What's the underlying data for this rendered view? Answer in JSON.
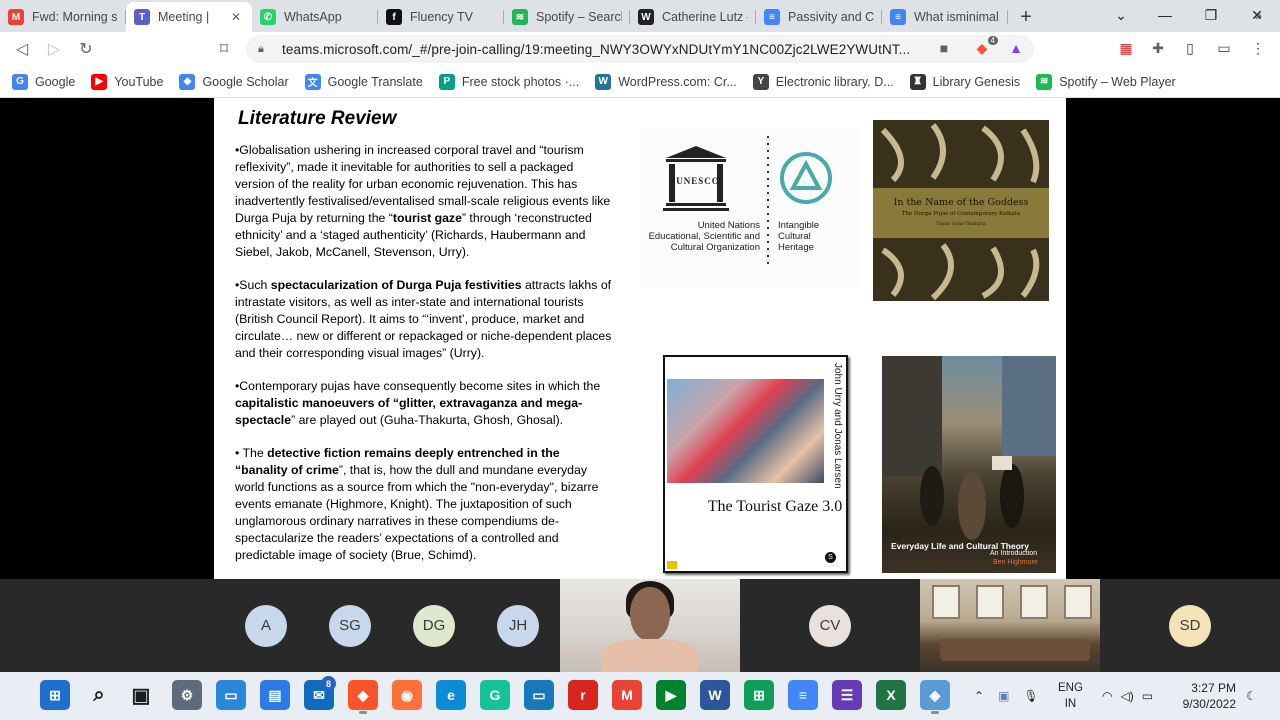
{
  "browser": {
    "tabs": [
      {
        "title": "Fwd: Morning se",
        "icon": "gmail-icon",
        "color": "#ea4335",
        "glyph": "M"
      },
      {
        "title": "Meeting |",
        "icon": "teams-icon",
        "color": "#5b5fc7",
        "glyph": "T",
        "active": true
      },
      {
        "title": "WhatsApp",
        "icon": "whatsapp-icon",
        "color": "#25d366",
        "glyph": "✆"
      },
      {
        "title": "Fluency TV",
        "icon": "fluency-icon",
        "color": "#111111",
        "glyph": "f"
      },
      {
        "title": "Spotify – Search",
        "icon": "spotify-icon",
        "color": "#1db954",
        "glyph": "≋"
      },
      {
        "title": "Catherine Lutz -",
        "icon": "wikipedia-icon",
        "color": "#222222",
        "glyph": "W"
      },
      {
        "title": "Passivity and Cre",
        "icon": "docs-icon",
        "color": "#4285f4",
        "glyph": "≡"
      },
      {
        "title": "What isminimal.c",
        "icon": "docs-icon",
        "color": "#4285f4",
        "glyph": "≡"
      }
    ],
    "new_tab": "+",
    "url": "teams.microsoft.com/_#/pre-join-calling/19:meeting_NWY3OWYxNDUtYmY1NC00Zjc2LWE2YWUtNT...",
    "brave_badge": "4",
    "bookmarks": [
      {
        "label": "Google",
        "icon": "google-icon",
        "color": "#4285f4",
        "glyph": "G"
      },
      {
        "label": "YouTube",
        "icon": "youtube-icon",
        "color": "#ff0000",
        "glyph": "▶"
      },
      {
        "label": "Google Scholar",
        "icon": "scholar-icon",
        "color": "#4285f4",
        "glyph": "◆"
      },
      {
        "label": "Google Translate",
        "icon": "translate-icon",
        "color": "#4285f4",
        "glyph": "文"
      },
      {
        "label": "Free stock photos ·...",
        "icon": "pexels-icon",
        "color": "#05a081",
        "glyph": "P"
      },
      {
        "label": "WordPress.com: Cr...",
        "icon": "wordpress-icon",
        "color": "#21759b",
        "glyph": "W"
      },
      {
        "label": "Electronic library. D...",
        "icon": "library-icon",
        "color": "#444444",
        "glyph": "Y"
      },
      {
        "label": "Library Genesis",
        "icon": "libgen-icon",
        "color": "#333333",
        "glyph": "♜"
      },
      {
        "label": "Spotify – Web Player",
        "icon": "spotify-icon",
        "color": "#1db954",
        "glyph": "≋"
      }
    ],
    "bookmarks_more": "»"
  },
  "slide": {
    "title": "Literature Review",
    "paragraphs": [
      {
        "html": "•Globalisation ushering in increased  corporal travel and “tourism reflexivity”, made it inevitable for authorities to sell a packaged version of the reality for urban economic rejuvenation. This has inadvertently festivalised/eventalised small-scale religious events like Durga Puja by returning the “<b>tourist gaze</b>” through ‘reconstructed ethnicity’ and a ‘staged authenticity’ (Richards, Haubermann and Siebel, Jakob, McCanell, Stevenson, Urry)."
      },
      {
        "html": "•Such <b>spectacularization of Durga Puja festivities</b> attracts lakhs of intrastate visitors, as well as inter-state and international tourists (British Council Report). It aims to “‘invent’, produce, market and circulate… new or different or repackaged or niche-dependent places and their corresponding visual images”  (Urry)."
      },
      {
        "html": "•Contemporary pujas have consequently become sites in which  the <b>capitalistic manoeuvers of “glitter, extravaganza and mega-spectacle</b>” are played out  (Guha-Thakurta, Ghosh, Ghosal)."
      },
      {
        "html": "• The <b>detective fiction remains deeply entrenched in  the “banality of crime</b>”, that is, how the dull and mundane everyday world functions as a source from which the \"non-everyday\", bizarre events emanate (Highmore, Knight). The juxtaposition of such unglamorous ordinary narratives in these compendiums de-spectacularize the readers’ expectations of a controlled and predictable image of society (Brue, Schimd)."
      }
    ],
    "unesco": {
      "wordmark": "UNESCO",
      "org_lines": [
        "United Nations",
        "Educational, Scientific and",
        "Cultural Organization"
      ],
      "heritage_lines": [
        "Intangible",
        "Cultural",
        "Heritage"
      ]
    },
    "book_goddess": {
      "title": "In the Name of the Goddess",
      "subtitle": "The Durga Pujas of Contemporary Kolkata",
      "author": "Tapati Guha-Thakurta"
    },
    "book_gaze": {
      "authors": "John Urry and Jonas Larsen",
      "title": "The Tourist Gaze 3.0",
      "publisher_mark": "S"
    },
    "book_everyday": {
      "title": "Everyday Life and Cultural Theory",
      "subtitle": "An Introduction",
      "author": "Ben Highmore"
    }
  },
  "participants": [
    {
      "initials": "A",
      "color": "#c7d7ec"
    },
    {
      "initials": "SG",
      "color": "#c7d7ec"
    },
    {
      "initials": "DG",
      "color": "#dfe8cc"
    },
    {
      "initials": "JH",
      "color": "#c7d7ec"
    },
    {
      "initials": "CV",
      "color": "#e9e1db"
    },
    {
      "initials": "SD",
      "color": "#f5e3b8"
    }
  ],
  "taskbar": {
    "apps": [
      {
        "name": "start-icon",
        "color": "#1f6fd1",
        "glyph": "⊞"
      },
      {
        "name": "search-icon",
        "color": "#e9eef5",
        "glyph": "⌕"
      },
      {
        "name": "task-view-icon",
        "color": "#e9eef5",
        "glyph": "▣"
      },
      {
        "name": "settings-icon",
        "color": "#5d6b7c",
        "glyph": "⚙"
      },
      {
        "name": "snip-icon",
        "color": "#2b88d8",
        "glyph": "▭"
      },
      {
        "name": "notepad-icon",
        "color": "#2c7be5",
        "glyph": "▤"
      },
      {
        "name": "mail-icon",
        "color": "#0f6cbd",
        "glyph": "✉",
        "badge": "8"
      },
      {
        "name": "brave-icon",
        "color": "#fb542b",
        "glyph": "◆",
        "running": true
      },
      {
        "name": "firefox-icon",
        "color": "#ff7139",
        "glyph": "◉"
      },
      {
        "name": "edge-icon",
        "color": "#0c8bd6",
        "glyph": "e"
      },
      {
        "name": "grammarly-icon",
        "color": "#15c39a",
        "glyph": "G"
      },
      {
        "name": "remote-desktop-icon",
        "color": "#1779ba",
        "glyph": "▭"
      },
      {
        "name": "rr-icon",
        "color": "#d7261e",
        "glyph": "r"
      },
      {
        "name": "gmail-icon",
        "color": "#ea4335",
        "glyph": "M"
      },
      {
        "name": "meet-icon",
        "color": "#00832d",
        "glyph": "▶"
      },
      {
        "name": "word-icon",
        "color": "#2b579a",
        "glyph": "W"
      },
      {
        "name": "sheets-icon",
        "color": "#0f9d58",
        "glyph": "⊞"
      },
      {
        "name": "docs-icon",
        "color": "#4285f4",
        "glyph": "≡"
      },
      {
        "name": "forms-icon",
        "color": "#673ab7",
        "glyph": "☰"
      },
      {
        "name": "excel-icon",
        "color": "#217346",
        "glyph": "X"
      },
      {
        "name": "app-icon",
        "color": "#5a9bd4",
        "glyph": "◈",
        "running": true
      }
    ],
    "language_line1": "ENG",
    "language_line2": "IN",
    "time": "3:27 PM",
    "date": "9/30/2022"
  }
}
